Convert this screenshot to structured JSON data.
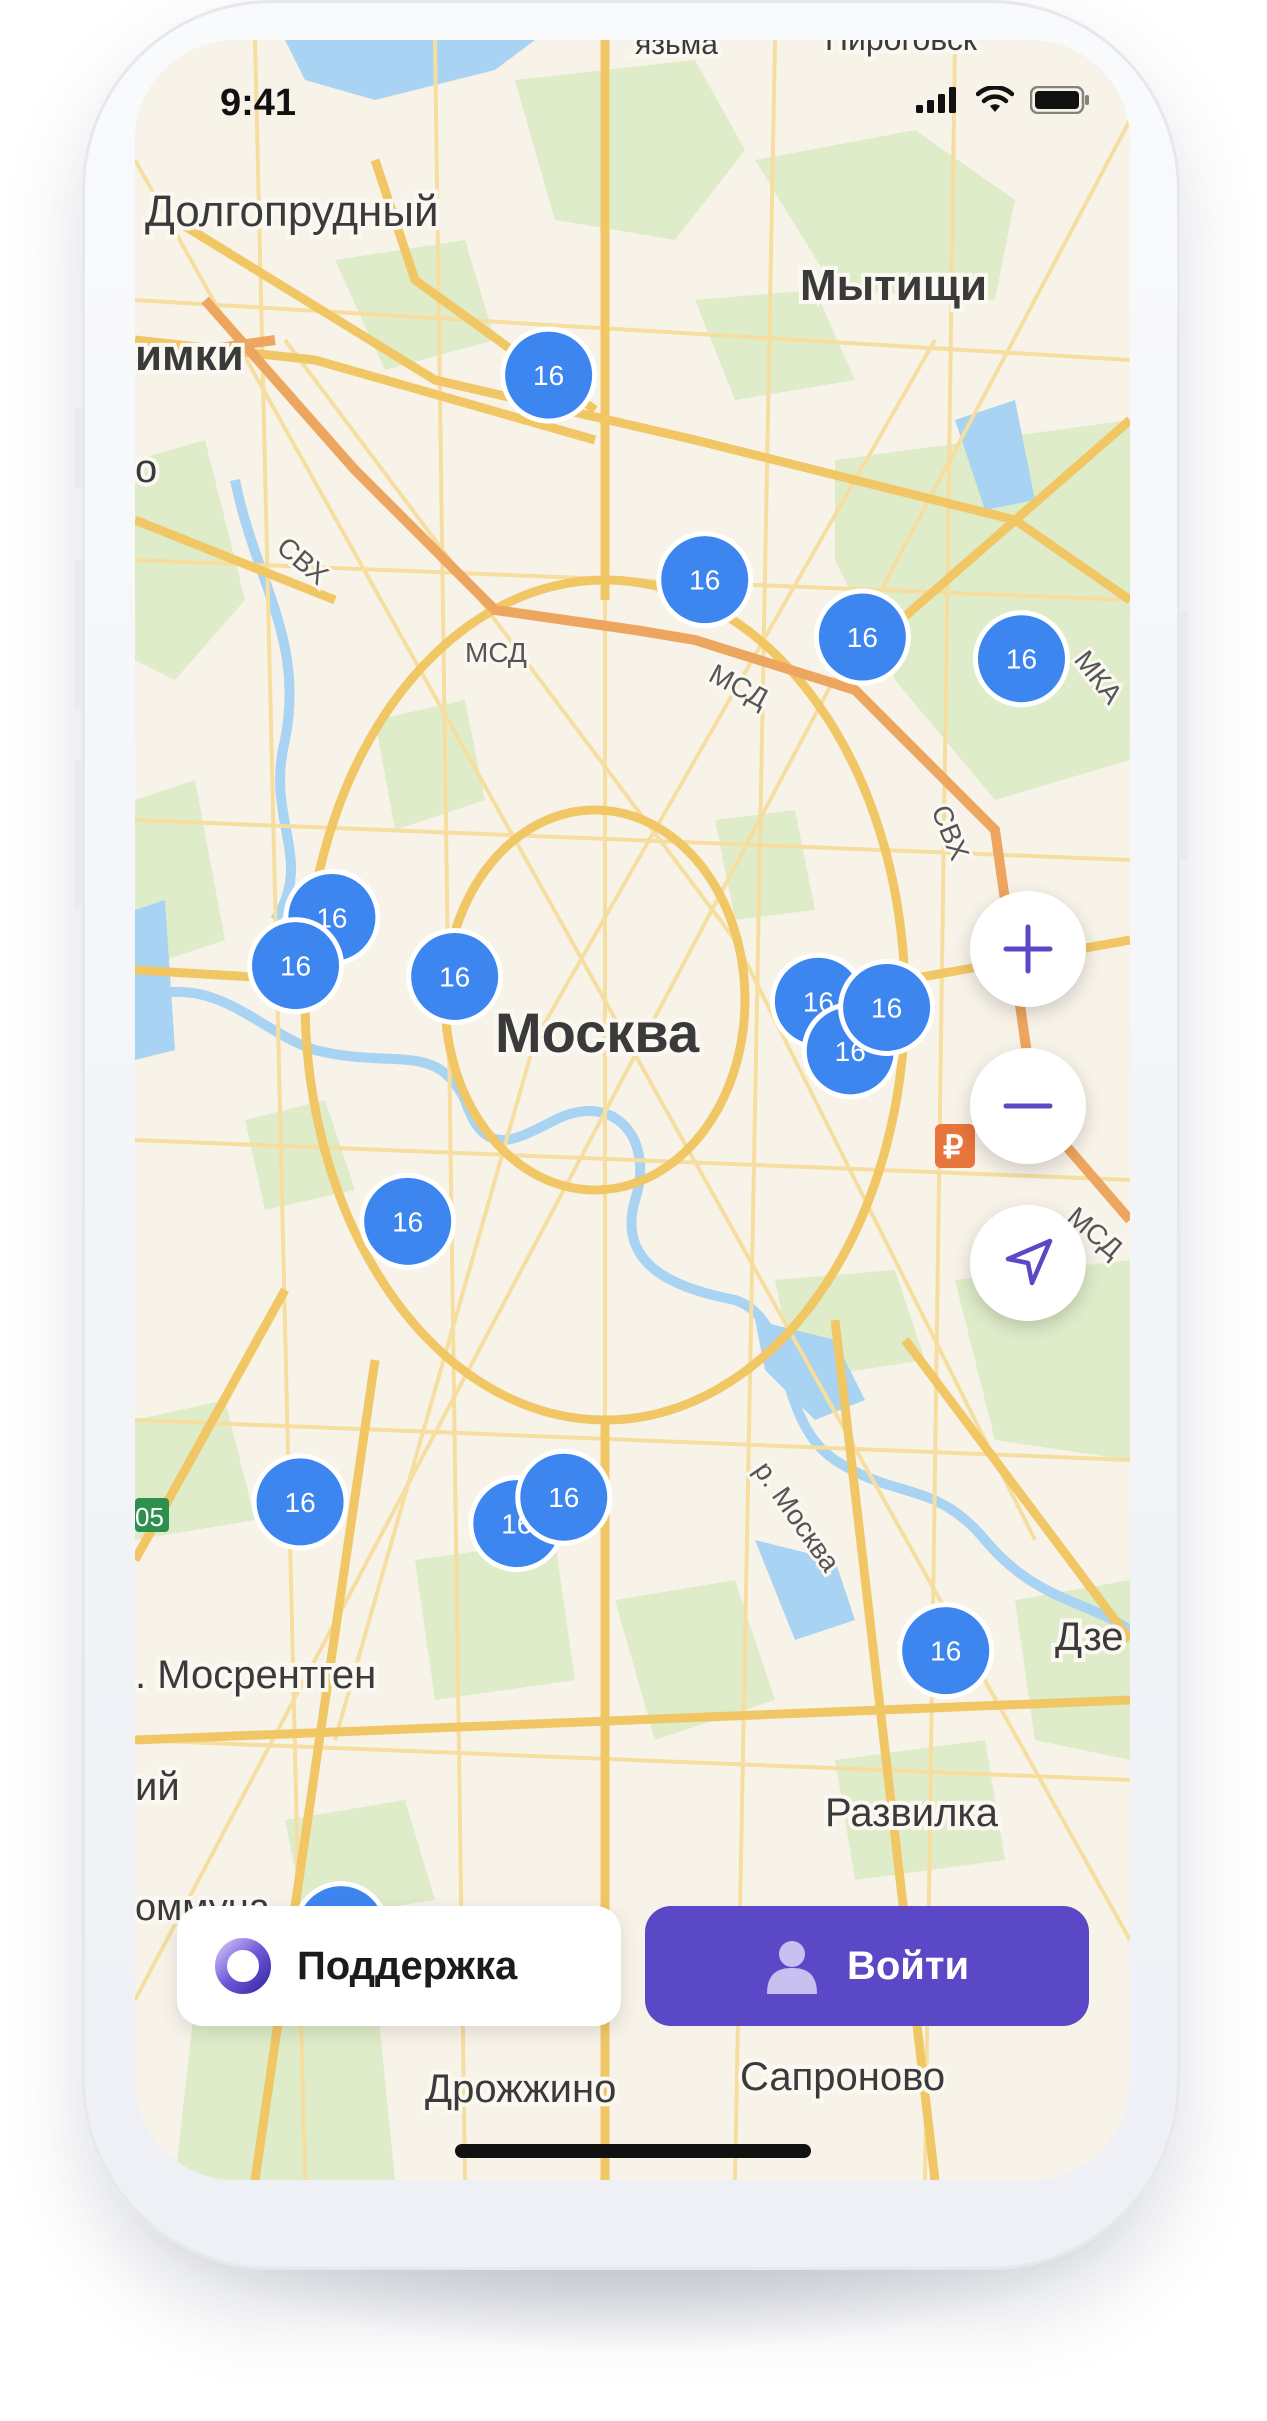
{
  "status_bar": {
    "time": "9:41"
  },
  "map": {
    "city_label": "Москва",
    "places": [
      {
        "id": "dolgoprudny",
        "name": "Долгопрудный"
      },
      {
        "id": "mytishchi",
        "name": "Мытищи"
      },
      {
        "id": "khimki",
        "name": "имки"
      },
      {
        "id": "mosrentgen",
        "name": ". Мосрентген"
      },
      {
        "id": "razvilka",
        "name": "Развилка"
      },
      {
        "id": "drozhzhino",
        "name": "Дрожжино"
      },
      {
        "id": "sapronovo",
        "name": "Сапроново"
      },
      {
        "id": "dze",
        "name": "Дзе"
      },
      {
        "id": "ii",
        "name": "ий"
      },
      {
        "id": "kommuna",
        "name": "оммуна"
      },
      {
        "id": "o",
        "name": "о"
      },
      {
        "id": "pirogovsk",
        "name": "Пироговск"
      },
      {
        "id": "klyazma",
        "name": "язьма"
      }
    ],
    "road_labels": [
      {
        "id": "svkh1",
        "text": "СВХ"
      },
      {
        "id": "msd1",
        "text": "МСД"
      },
      {
        "id": "msd2",
        "text": "МСД"
      },
      {
        "id": "svkh2",
        "text": "СВХ"
      },
      {
        "id": "mkad",
        "text": "МКА"
      },
      {
        "id": "msd3",
        "text": "МСД"
      },
      {
        "id": "river",
        "text": "р. Москва"
      },
      {
        "id": "route",
        "text": "05"
      }
    ],
    "clusters": [
      {
        "id": "c1",
        "count": "16"
      },
      {
        "id": "c2",
        "count": "16"
      },
      {
        "id": "c3",
        "count": "16"
      },
      {
        "id": "c4",
        "count": "16"
      },
      {
        "id": "c5",
        "count": "16"
      },
      {
        "id": "c6",
        "count": "16"
      },
      {
        "id": "c7",
        "count": "16"
      },
      {
        "id": "c8",
        "count": "16"
      },
      {
        "id": "c9",
        "count": "16"
      },
      {
        "id": "c10",
        "count": "16"
      },
      {
        "id": "c11",
        "count": "16"
      },
      {
        "id": "c12",
        "count": "16"
      },
      {
        "id": "c13",
        "count": "16"
      },
      {
        "id": "c14",
        "count": "16"
      },
      {
        "id": "c15",
        "count": "16"
      },
      {
        "id": "c16",
        "count": "16"
      }
    ],
    "cluster_color": "#3d86f0",
    "currency_marker": "₽"
  },
  "controls": {
    "zoom_in_icon": "plus-icon",
    "zoom_out_icon": "minus-icon",
    "locate_icon": "navigation-arrow-icon",
    "accent": "#5a48c6"
  },
  "actions": {
    "support_label": "Поддержка",
    "login_label": "Войти"
  }
}
